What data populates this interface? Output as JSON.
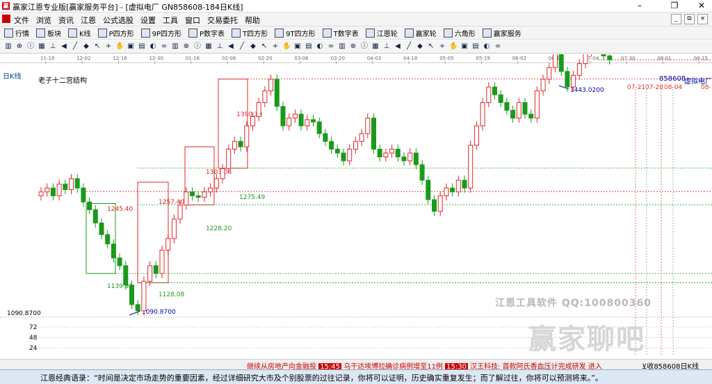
{
  "window": {
    "title": "赢家江恩专业版[赢家服务平台] - [虚拟电厂  GN858608-184日K线]",
    "minimize": "–",
    "maximize": "❐",
    "close": "✕"
  },
  "menu": {
    "items": [
      "文件",
      "浏览",
      "资讯",
      "江恩",
      "公式选股",
      "设置",
      "工具",
      "窗口",
      "交易委托",
      "帮助"
    ],
    "right_controls": [
      "_",
      "⧉",
      "×"
    ]
  },
  "toolbar1": {
    "buttons": [
      {
        "icon": "list-icon",
        "label": "行情"
      },
      {
        "icon": "block-icon",
        "label": "板块"
      },
      {
        "icon": "kline-icon",
        "label": "K线"
      },
      {
        "icon": "square-icon",
        "label": "P四方形"
      },
      {
        "icon": "square-icon",
        "label": "9P四方形"
      },
      {
        "icon": "table-icon",
        "label": "P数字表"
      },
      {
        "icon": "square-icon",
        "label": "T四方形"
      },
      {
        "icon": "square-icon",
        "label": "9T四方形"
      },
      {
        "icon": "table-icon",
        "label": "T数字表"
      },
      {
        "icon": "wheel-icon",
        "label": "江恩轮"
      },
      {
        "icon": "wheel-icon",
        "label": "赢家轮"
      },
      {
        "icon": "hexagon-icon",
        "label": "六角形"
      },
      {
        "icon": "dollar-icon",
        "label": "赢家服务"
      }
    ]
  },
  "toolbar2": {
    "icons": [
      "bar-chart-icon",
      "zoom-icon",
      "info-icon",
      "calendar-icon",
      "ruler-icon",
      "arrow-icon",
      "line-icon",
      "gann-icon",
      "cursor-icon",
      "cross-icon",
      "hand-icon",
      "save-icon",
      "print-icon",
      "palette-icon",
      "infinity-icon"
    ]
  },
  "chart": {
    "period": "日K线",
    "indicator_name": "老子十二宫结构",
    "code": "858608",
    "name": "虚拟电厂",
    "date_axis": [
      "11-18",
      "12-02",
      "12-16",
      "12-30",
      "01-16",
      "02-06",
      "02-20",
      "03-06",
      "03-20",
      "04-03",
      "04-18",
      "05-05",
      "05-19",
      "06-02",
      "06-16",
      "07-04",
      "07-30",
      "08-01",
      "08-15"
    ],
    "future_dates": [
      "07-21",
      "07-28",
      "08-04",
      "08-"
    ],
    "low_label": "1090.8700",
    "low_axis_label": "1090.8700",
    "high_label": "1443.0200",
    "levels": [
      "1390.19",
      "1303.04",
      "1275.49",
      "1257.40",
      "1245.40",
      "1228.20",
      "1139.99",
      "1128.08"
    ],
    "volume_axis": [
      "72",
      "48",
      "24"
    ]
  },
  "status": {
    "ticker_items": [
      {
        "text": "继续从房地产向金融投",
        "time": "15:45"
      },
      {
        "text": "乌干达埃博拉确诊病例增至11例",
        "time": "15:30"
      },
      {
        "text": "汉王科技: 首款阿氏香血压计完成研发 进入"
      }
    ],
    "right_text": "⊻收858608日K线"
  },
  "quote": "江恩经典语录：“时间是决定市场走势的重要因素，经过详细研究大市及个别股票的过往记录，你将可以证明，历史确实重复发生；而了解过往，你将可以预测将来。”。",
  "watermark": {
    "line1": "江恩工具软件   QQ:100800360",
    "line2": "赢家聊吧"
  },
  "colors": {
    "up": "#e0242a",
    "down": "#1a9a1a",
    "accent": "#c00000",
    "axis_blue": "#0040a0"
  }
}
